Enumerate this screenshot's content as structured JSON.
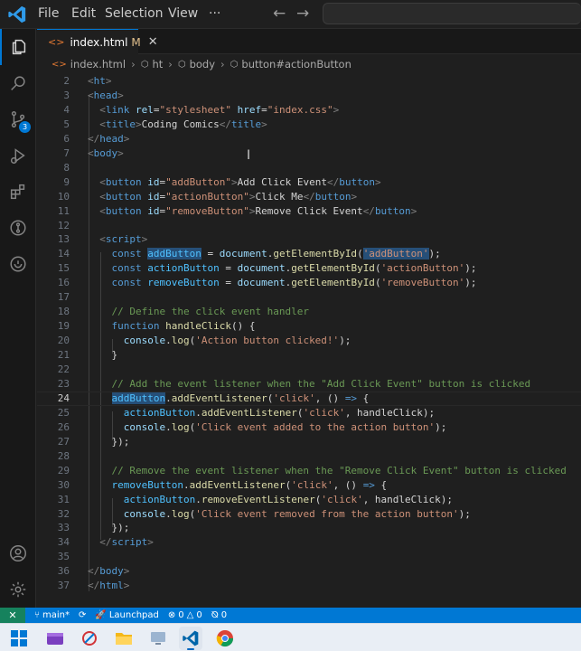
{
  "titlebar": {
    "menu": [
      "File",
      "Edit",
      "Selection",
      "View",
      "···"
    ],
    "nav_back": "←",
    "nav_forward": "→",
    "search_placeholder": ""
  },
  "tab": {
    "file_icon": "<>",
    "label": "index.html",
    "modified": "M",
    "close": "✕"
  },
  "breadcrumb": [
    "index.html",
    "ht",
    "body",
    "button#actionButton"
  ],
  "editor": {
    "lines": [
      {
        "n": "2",
        "tokens": [
          [
            "t-br",
            "<"
          ],
          [
            "t-tag",
            "ht"
          ],
          [
            "t-br",
            ">"
          ]
        ]
      },
      {
        "n": "3",
        "tokens": [
          [
            "t-br",
            "<"
          ],
          [
            "t-tag",
            "head"
          ],
          [
            "t-br",
            ">"
          ]
        ]
      },
      {
        "n": "4",
        "tokens": [
          [
            "t-tx",
            "  "
          ],
          [
            "t-br",
            "<"
          ],
          [
            "t-tag",
            "link"
          ],
          [
            "t-tx",
            " "
          ],
          [
            "t-at",
            "rel"
          ],
          [
            "t-tx",
            "="
          ],
          [
            "t-st",
            "\"stylesheet\""
          ],
          [
            "t-tx",
            " "
          ],
          [
            "t-at",
            "href"
          ],
          [
            "t-tx",
            "="
          ],
          [
            "t-st",
            "\"index.css\""
          ],
          [
            "t-br",
            ">"
          ]
        ]
      },
      {
        "n": "5",
        "tokens": [
          [
            "t-tx",
            "  "
          ],
          [
            "t-br",
            "<"
          ],
          [
            "t-tag",
            "title"
          ],
          [
            "t-br",
            ">"
          ],
          [
            "t-tx",
            "Coding Comics"
          ],
          [
            "t-br",
            "</"
          ],
          [
            "t-tag",
            "title"
          ],
          [
            "t-br",
            ">"
          ]
        ]
      },
      {
        "n": "6",
        "tokens": [
          [
            "t-br",
            "</"
          ],
          [
            "t-tag",
            "head"
          ],
          [
            "t-br",
            ">"
          ]
        ]
      },
      {
        "n": "7",
        "tokens": [
          [
            "t-br",
            "<"
          ],
          [
            "t-tag",
            "body"
          ],
          [
            "t-br",
            ">"
          ]
        ]
      },
      {
        "n": "8",
        "tokens": []
      },
      {
        "n": "9",
        "tokens": [
          [
            "t-tx",
            "  "
          ],
          [
            "t-br",
            "<"
          ],
          [
            "t-tag",
            "button"
          ],
          [
            "t-tx",
            " "
          ],
          [
            "t-at",
            "id"
          ],
          [
            "t-tx",
            "="
          ],
          [
            "t-st",
            "\"addButton\""
          ],
          [
            "t-br",
            ">"
          ],
          [
            "t-tx",
            "Add Click Event"
          ],
          [
            "t-br",
            "</"
          ],
          [
            "t-tag",
            "button"
          ],
          [
            "t-br",
            ">"
          ]
        ]
      },
      {
        "n": "10",
        "tokens": [
          [
            "t-tx",
            "  "
          ],
          [
            "t-br",
            "<"
          ],
          [
            "t-tag",
            "button"
          ],
          [
            "t-tx",
            " "
          ],
          [
            "t-at",
            "id"
          ],
          [
            "t-tx",
            "="
          ],
          [
            "t-st",
            "\"actionButton\""
          ],
          [
            "t-br",
            ">"
          ],
          [
            "t-tx",
            "Click Me"
          ],
          [
            "t-br",
            "</"
          ],
          [
            "t-tag",
            "button"
          ],
          [
            "t-br",
            ">"
          ]
        ]
      },
      {
        "n": "11",
        "tokens": [
          [
            "t-tx",
            "  "
          ],
          [
            "t-br",
            "<"
          ],
          [
            "t-tag",
            "button"
          ],
          [
            "t-tx",
            " "
          ],
          [
            "t-at",
            "id"
          ],
          [
            "t-tx",
            "="
          ],
          [
            "t-st",
            "\"removeButton\""
          ],
          [
            "t-br",
            ">"
          ],
          [
            "t-tx",
            "Remove Click Event"
          ],
          [
            "t-br",
            "</"
          ],
          [
            "t-tag",
            "button"
          ],
          [
            "t-br",
            ">"
          ]
        ]
      },
      {
        "n": "12",
        "tokens": []
      },
      {
        "n": "13",
        "tokens": [
          [
            "t-tx",
            "  "
          ],
          [
            "t-br",
            "<"
          ],
          [
            "t-tag",
            "script"
          ],
          [
            "t-br",
            ">"
          ]
        ]
      },
      {
        "n": "14",
        "tokens": [
          [
            "t-tx",
            "    "
          ],
          [
            "t-kw",
            "const"
          ],
          [
            "t-tx",
            " "
          ],
          [
            "t-var hl",
            "addButton"
          ],
          [
            "t-pn",
            " = "
          ],
          [
            "t-pr",
            "document"
          ],
          [
            "t-pn",
            "."
          ],
          [
            "t-fn",
            "getElementById"
          ],
          [
            "t-pn",
            "("
          ],
          [
            "t-st hl",
            "'addButton'"
          ],
          [
            "t-pn",
            ");"
          ]
        ]
      },
      {
        "n": "15",
        "tokens": [
          [
            "t-tx",
            "    "
          ],
          [
            "t-kw",
            "const"
          ],
          [
            "t-tx",
            " "
          ],
          [
            "t-var",
            "actionButton"
          ],
          [
            "t-pn",
            " = "
          ],
          [
            "t-pr",
            "document"
          ],
          [
            "t-pn",
            "."
          ],
          [
            "t-fn",
            "getElementById"
          ],
          [
            "t-pn",
            "("
          ],
          [
            "t-st",
            "'actionButton'"
          ],
          [
            "t-pn",
            ");"
          ]
        ]
      },
      {
        "n": "16",
        "tokens": [
          [
            "t-tx",
            "    "
          ],
          [
            "t-kw",
            "const"
          ],
          [
            "t-tx",
            " "
          ],
          [
            "t-var",
            "removeButton"
          ],
          [
            "t-pn",
            " = "
          ],
          [
            "t-pr",
            "document"
          ],
          [
            "t-pn",
            "."
          ],
          [
            "t-fn",
            "getElementById"
          ],
          [
            "t-pn",
            "("
          ],
          [
            "t-st",
            "'removeButton'"
          ],
          [
            "t-pn",
            ");"
          ]
        ]
      },
      {
        "n": "17",
        "tokens": []
      },
      {
        "n": "18",
        "tokens": [
          [
            "t-tx",
            "    "
          ],
          [
            "t-cm",
            "// Define the click event handler"
          ]
        ]
      },
      {
        "n": "19",
        "tokens": [
          [
            "t-tx",
            "    "
          ],
          [
            "t-kw",
            "function"
          ],
          [
            "t-tx",
            " "
          ],
          [
            "t-fn",
            "handleClick"
          ],
          [
            "t-pn",
            "() {"
          ]
        ]
      },
      {
        "n": "20",
        "tokens": [
          [
            "t-tx",
            "      "
          ],
          [
            "t-pr",
            "console"
          ],
          [
            "t-pn",
            "."
          ],
          [
            "t-fn",
            "log"
          ],
          [
            "t-pn",
            "("
          ],
          [
            "t-st",
            "'Action button clicked!'"
          ],
          [
            "t-pn",
            ");"
          ]
        ]
      },
      {
        "n": "21",
        "tokens": [
          [
            "t-tx",
            "    "
          ],
          [
            "t-pn",
            "}"
          ]
        ]
      },
      {
        "n": "22",
        "tokens": []
      },
      {
        "n": "23",
        "tokens": [
          [
            "t-tx",
            "    "
          ],
          [
            "t-cm",
            "// Add the event listener when the \"Add Click Event\" button is clicked"
          ]
        ]
      },
      {
        "n": "24",
        "tokens": [
          [
            "t-tx",
            "    "
          ],
          [
            "t-var hl",
            "addButton"
          ],
          [
            "t-pn",
            "."
          ],
          [
            "t-fn",
            "addEventListener"
          ],
          [
            "t-pn",
            "("
          ],
          [
            "t-st",
            "'click'"
          ],
          [
            "t-pn",
            ", () "
          ],
          [
            "t-kw",
            "=>"
          ],
          [
            "t-pn",
            " {"
          ]
        ]
      },
      {
        "n": "25",
        "tokens": [
          [
            "t-tx",
            "      "
          ],
          [
            "t-var",
            "actionButton"
          ],
          [
            "t-pn",
            "."
          ],
          [
            "t-fn",
            "addEventListener"
          ],
          [
            "t-pn",
            "("
          ],
          [
            "t-st",
            "'click'"
          ],
          [
            "t-pn",
            ", handleClick);"
          ]
        ]
      },
      {
        "n": "26",
        "tokens": [
          [
            "t-tx",
            "      "
          ],
          [
            "t-pr",
            "console"
          ],
          [
            "t-pn",
            "."
          ],
          [
            "t-fn",
            "log"
          ],
          [
            "t-pn",
            "("
          ],
          [
            "t-st",
            "'Click event added to the action button'"
          ],
          [
            "t-pn",
            ");"
          ]
        ]
      },
      {
        "n": "27",
        "tokens": [
          [
            "t-tx",
            "    "
          ],
          [
            "t-pn",
            "});"
          ]
        ]
      },
      {
        "n": "28",
        "tokens": []
      },
      {
        "n": "29",
        "tokens": [
          [
            "t-tx",
            "    "
          ],
          [
            "t-cm",
            "// Remove the event listener when the \"Remove Click Event\" button is clicked"
          ]
        ]
      },
      {
        "n": "30",
        "tokens": [
          [
            "t-tx",
            "    "
          ],
          [
            "t-var",
            "removeButton"
          ],
          [
            "t-pn",
            "."
          ],
          [
            "t-fn",
            "addEventListener"
          ],
          [
            "t-pn",
            "("
          ],
          [
            "t-st",
            "'click'"
          ],
          [
            "t-pn",
            ", () "
          ],
          [
            "t-kw",
            "=>"
          ],
          [
            "t-pn",
            " {"
          ]
        ]
      },
      {
        "n": "31",
        "tokens": [
          [
            "t-tx",
            "      "
          ],
          [
            "t-var",
            "actionButton"
          ],
          [
            "t-pn",
            "."
          ],
          [
            "t-fn",
            "removeEventListener"
          ],
          [
            "t-pn",
            "("
          ],
          [
            "t-st",
            "'click'"
          ],
          [
            "t-pn",
            ", handleClick);"
          ]
        ]
      },
      {
        "n": "32",
        "tokens": [
          [
            "t-tx",
            "      "
          ],
          [
            "t-pr",
            "console"
          ],
          [
            "t-pn",
            "."
          ],
          [
            "t-fn",
            "log"
          ],
          [
            "t-pn",
            "("
          ],
          [
            "t-st",
            "'Click event removed from the action button'"
          ],
          [
            "t-pn",
            ");"
          ]
        ]
      },
      {
        "n": "33",
        "tokens": [
          [
            "t-tx",
            "    "
          ],
          [
            "t-pn",
            "});"
          ]
        ]
      },
      {
        "n": "34",
        "tokens": [
          [
            "t-tx",
            "  "
          ],
          [
            "t-br",
            "</"
          ],
          [
            "t-tag",
            "script"
          ],
          [
            "t-br",
            ">"
          ]
        ]
      },
      {
        "n": "35",
        "tokens": []
      },
      {
        "n": "36",
        "tokens": [
          [
            "t-br",
            "</"
          ],
          [
            "t-tag",
            "body"
          ],
          [
            "t-br",
            ">"
          ]
        ]
      },
      {
        "n": "37",
        "tokens": [
          [
            "t-br",
            "</"
          ],
          [
            "t-tag",
            "html"
          ],
          [
            "t-br",
            ">"
          ]
        ]
      }
    ],
    "current_line": "24"
  },
  "statusbar": {
    "remote_icon": "✕",
    "branch": "main*",
    "sync_icon": "⟳",
    "launchpad": "Launchpad",
    "errors": "0",
    "warnings": "0",
    "ports": "0"
  },
  "colors": {
    "accent": "#0078d4",
    "remote": "#16825d",
    "editor_bg": "#1f1f1f"
  }
}
